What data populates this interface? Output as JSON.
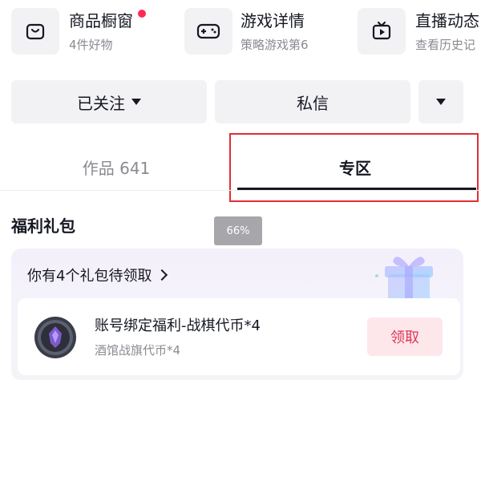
{
  "shortcuts": [
    {
      "title": "商品橱窗",
      "subtitle": "4件好物",
      "icon": "shop-bag-icon",
      "has_dot": true
    },
    {
      "title": "游戏详情",
      "subtitle": "策略游戏第6",
      "icon": "gamepad-icon",
      "has_dot": false
    },
    {
      "title": "直播动态",
      "subtitle": "查看历史记",
      "icon": "tv-icon",
      "has_dot": false
    }
  ],
  "actions": {
    "follow_label": "已关注",
    "message_label": "私信"
  },
  "tabs": {
    "works_label": "作品 641",
    "zone_label": "专区"
  },
  "section": {
    "title": "福利礼包"
  },
  "zoom_badge": "66%",
  "gift_card": {
    "header": "你有4个礼包待领取",
    "item_title": "账号绑定福利-战棋代币*4",
    "item_subtitle": "酒馆战旗代币*4",
    "claim_label": "领取"
  },
  "colors": {
    "accent_red": "#e02e36",
    "dot_red": "#fe2c55",
    "claim_text": "#e0365a",
    "claim_bg": "#fde7eb",
    "text_primary": "#161823",
    "text_secondary": "#8a8b91"
  }
}
